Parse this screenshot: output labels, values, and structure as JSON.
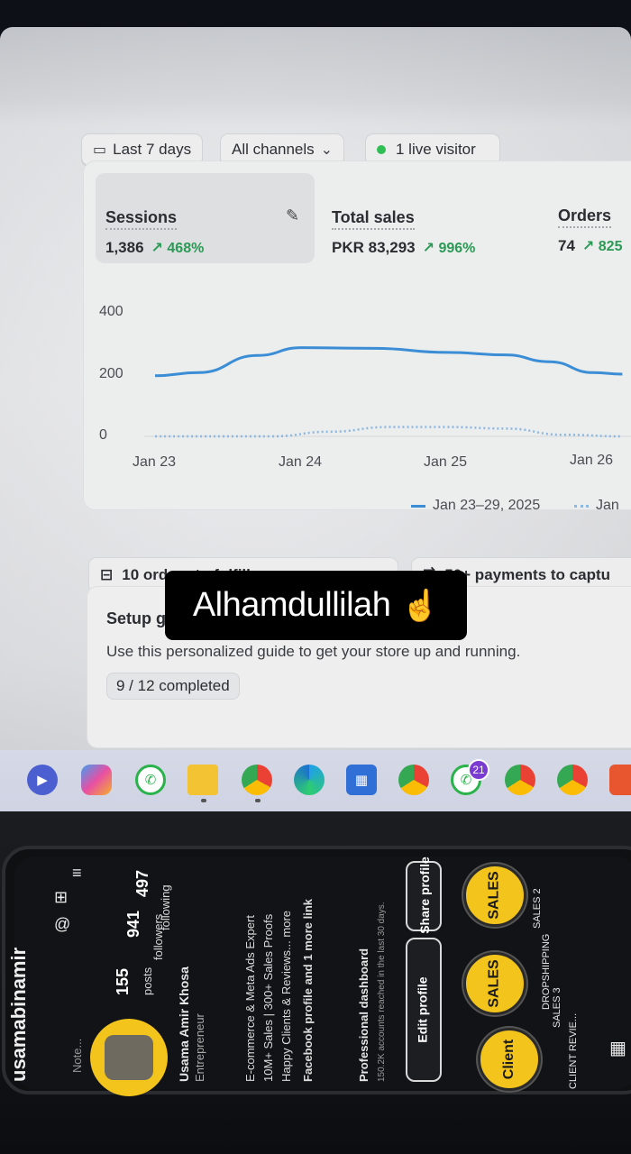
{
  "filters": {
    "date_range": "Last 7 days",
    "channels": "All channels",
    "live": "1 live visitor"
  },
  "metrics": {
    "sessions": {
      "label": "Sessions",
      "value": "1,386",
      "delta": "↗ 468%"
    },
    "total_sales": {
      "label": "Total sales",
      "value": "PKR 83,293",
      "delta": "↗ 996%"
    },
    "orders": {
      "label": "Orders",
      "value": "74",
      "delta": "↗ 825"
    }
  },
  "chart_data": {
    "type": "line",
    "x": [
      "Jan 23",
      "Jan 24",
      "Jan 25",
      "Jan 26"
    ],
    "ylim": [
      0,
      400
    ],
    "yticks": [
      "400",
      "200",
      "0"
    ],
    "series": [
      {
        "name": "Jan 23–29, 2025",
        "style": "solid",
        "color": "#3b8ed6",
        "points": [
          [
            0,
            195
          ],
          [
            0.3,
            205
          ],
          [
            0.7,
            260
          ],
          [
            1.0,
            285
          ],
          [
            1.5,
            283
          ],
          [
            2.0,
            270
          ],
          [
            2.4,
            262
          ],
          [
            2.7,
            240
          ],
          [
            3.0,
            205
          ],
          [
            3.2,
            200
          ]
        ]
      },
      {
        "name": "Jan",
        "style": "dotted",
        "color": "#8db8e2",
        "points": [
          [
            0,
            0
          ],
          [
            0.8,
            0
          ],
          [
            1.2,
            15
          ],
          [
            1.6,
            30
          ],
          [
            2.0,
            30
          ],
          [
            2.4,
            25
          ],
          [
            2.8,
            5
          ],
          [
            3.2,
            0
          ]
        ]
      }
    ],
    "legend": [
      "Jan 23–29, 2025",
      "Jan"
    ]
  },
  "tasks": {
    "fulfill": "10 orders to fulfill",
    "payments": "50+ payments to captu"
  },
  "setup": {
    "title": "Setup g",
    "desc": "Use this personalized guide to get your store up and running.",
    "progress": "9 / 12 completed"
  },
  "caption": {
    "text": "Alhamdullilah",
    "emoji": "☝️"
  },
  "taskbar": {
    "badge": "21"
  },
  "phone": {
    "username": "usamabinamir",
    "posts": "155",
    "posts_label": "posts",
    "followers": "941",
    "followers_label": "followers",
    "following": "497",
    "following_label": "following",
    "name": "Usama Amir Khosa",
    "role": "Entrepreneur",
    "bio1": "E-commerce & Meta Ads Expert",
    "bio2": "10M+ Sales | 300+ Sales Proofs",
    "bio3": "Happy Clients & Reviews... more",
    "link": "Facebook profile and 1 more link",
    "dashboard": "Professional dashboard",
    "dashboard_sub": "150.2K accounts reached in the last 30 days.",
    "edit": "Edit profile",
    "share": "Share profile",
    "note": "Note...",
    "highlights": [
      "SALES",
      "SALES",
      "Client",
      "SALES 2",
      "DROPSHIPPING",
      "SALES 3",
      "CLIENT REVIE..."
    ]
  }
}
